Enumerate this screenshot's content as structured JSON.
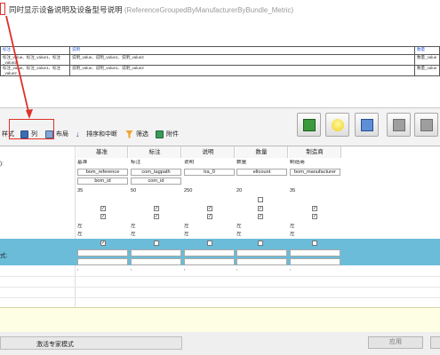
{
  "title": {
    "text": "同时显示设备说明及设备型号说明",
    "subtitle": "(ReferenceGroupedByManufacturerByBundle_Metric)"
  },
  "preview_table": {
    "header": [
      "标注",
      "说明",
      "数量"
    ],
    "rows": [
      [
        "标注_value、标注_value1、标注_value2",
        "说明_value、说明_value1、说明_value2",
        "数量_value"
      ],
      [
        "标注_value、标注_value1、标注_value2",
        "说明_value、说明_value1、说明_value2",
        "数量_value"
      ]
    ]
  },
  "toolbar": {
    "style_label": "样式",
    "column_label": "列",
    "layout_label": "布局",
    "sort_label": "排序和中断",
    "filter_label": "筛选",
    "attachment_label": "附件"
  },
  "grid": {
    "left_labels": {
      "row1": "):",
      "row2": "式:"
    },
    "columns": [
      {
        "header": "基准",
        "field": "基准",
        "property": "bom_reference",
        "id": "bom_id",
        "width": "35",
        "align1": "左",
        "align2": "左",
        "chk1": true,
        "chk2": true,
        "chk3": false,
        "band_chk": true
      },
      {
        "header": "标注",
        "field": "标注",
        "property": "com_tagpath",
        "id": "com_id",
        "width": "50",
        "align1": "左",
        "align2": "左",
        "chk1": true,
        "chk2": true,
        "chk3": false,
        "band_chk": false
      },
      {
        "header": "说明",
        "field": "说明",
        "property": "tra_0",
        "id": "",
        "width": "250",
        "align1": "左",
        "align2": "左",
        "chk1": true,
        "chk2": true,
        "chk3": false,
        "band_chk": false
      },
      {
        "header": "数量",
        "field": "数量",
        "property": "eltcount",
        "id": "",
        "width": "20",
        "align1": "左",
        "align2": "左",
        "chk1": true,
        "chk2": true,
        "chk3": true,
        "band_chk": false
      },
      {
        "header": "制造商",
        "field": "制造商",
        "property": "bom_manufacturer",
        "id": "",
        "width": "35",
        "align1": "左",
        "align2": "左",
        "chk1": true,
        "chk2": true,
        "chk3": false,
        "band_chk": false
      }
    ],
    "dot": ","
  },
  "status": {
    "expert_mode": "激活专家模式",
    "apply": "应用"
  },
  "colors": {
    "accent_red": "#e0302a",
    "band_blue": "#6bbcd8",
    "info_yellow": "#fefee4"
  },
  "icons": [
    "style-icon",
    "column-icon",
    "layout-icon",
    "sort-icon",
    "filter-icon",
    "attachment-icon",
    "table-icon",
    "bulb-icon",
    "preview-icon",
    "insert-left-icon",
    "insert-right-icon"
  ]
}
